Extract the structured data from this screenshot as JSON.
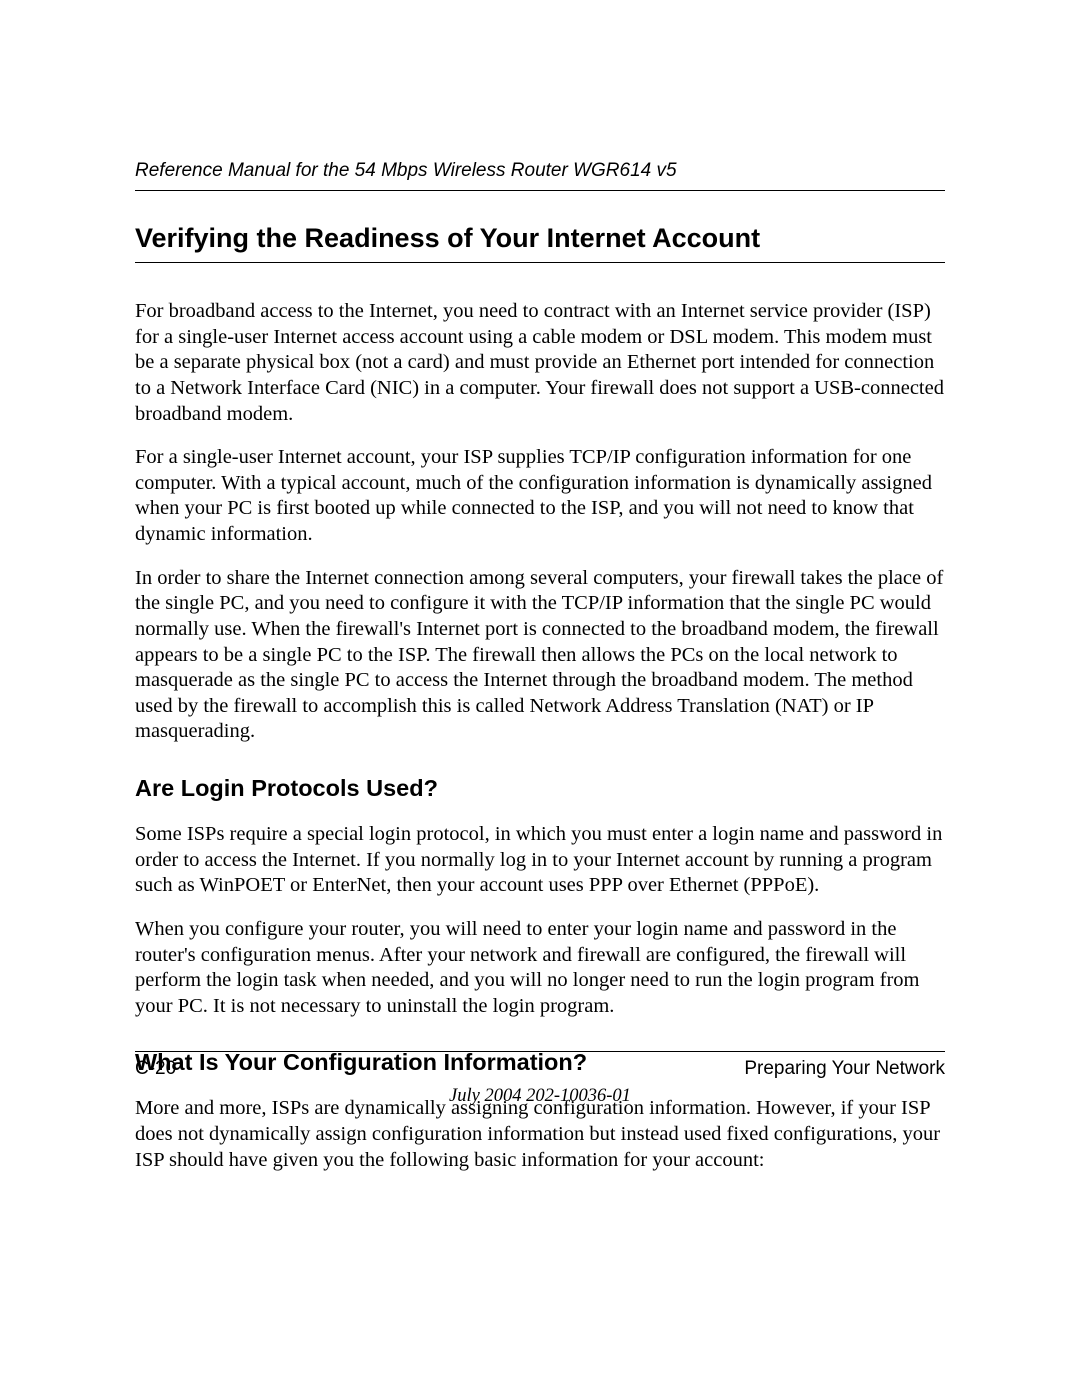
{
  "header": {
    "title": "Reference Manual for the 54 Mbps Wireless Router WGR614 v5"
  },
  "content": {
    "mainHeading": "Verifying the Readiness of Your Internet Account",
    "para1": "For broadband access to the Internet, you need to contract with an Internet service provider (ISP) for a single-user Internet access account using a cable modem or DSL modem. This modem must be a separate physical box (not a card) and must provide an Ethernet port intended for connection to a Network Interface Card (NIC) in a computer. Your firewall does not support a USB-connected broadband modem.",
    "para2": "For a single-user Internet account, your ISP supplies TCP/IP configuration information for one computer. With a typical account, much of the configuration information is dynamically assigned when your PC is first booted up while connected to the ISP, and you will not need to know that dynamic information.",
    "para3": "In order to share the Internet connection among several computers, your firewall takes the place of the single PC, and you need to configure it with the TCP/IP information that the single PC would normally use. When the firewall's Internet port is connected to the broadband modem, the firewall appears to be a single PC to the ISP. The firewall then allows the PCs on the local network to masquerade as the single PC to access the Internet through the broadband modem. The method used by the firewall to accomplish this is called Network Address Translation (NAT) or IP masquerading.",
    "subHeading1": "Are Login Protocols Used?",
    "para4": "Some ISPs require a special login protocol, in which you must enter a login name and password in order to access the Internet. If you normally log in to your Internet account by running a program such as WinPOET or EnterNet, then your account uses PPP over Ethernet (PPPoE).",
    "para5": "When you configure your router, you will need to enter your login name and password in the router's configuration menus. After your network and firewall are configured, the firewall will perform the login task when needed, and you will no longer need to run the login program from your PC. It is not necessary to uninstall the login program.",
    "subHeading2": "What Is Your Configuration Information?",
    "para6": "More and more, ISPs are dynamically assigning configuration information. However, if your ISP does not dynamically assign configuration information but instead used fixed configurations, your ISP should have given you the following basic information for your account:"
  },
  "footer": {
    "pageNumber": "C-20",
    "section": "Preparing Your Network",
    "dateLine": "July 2004 202-10036-01"
  }
}
